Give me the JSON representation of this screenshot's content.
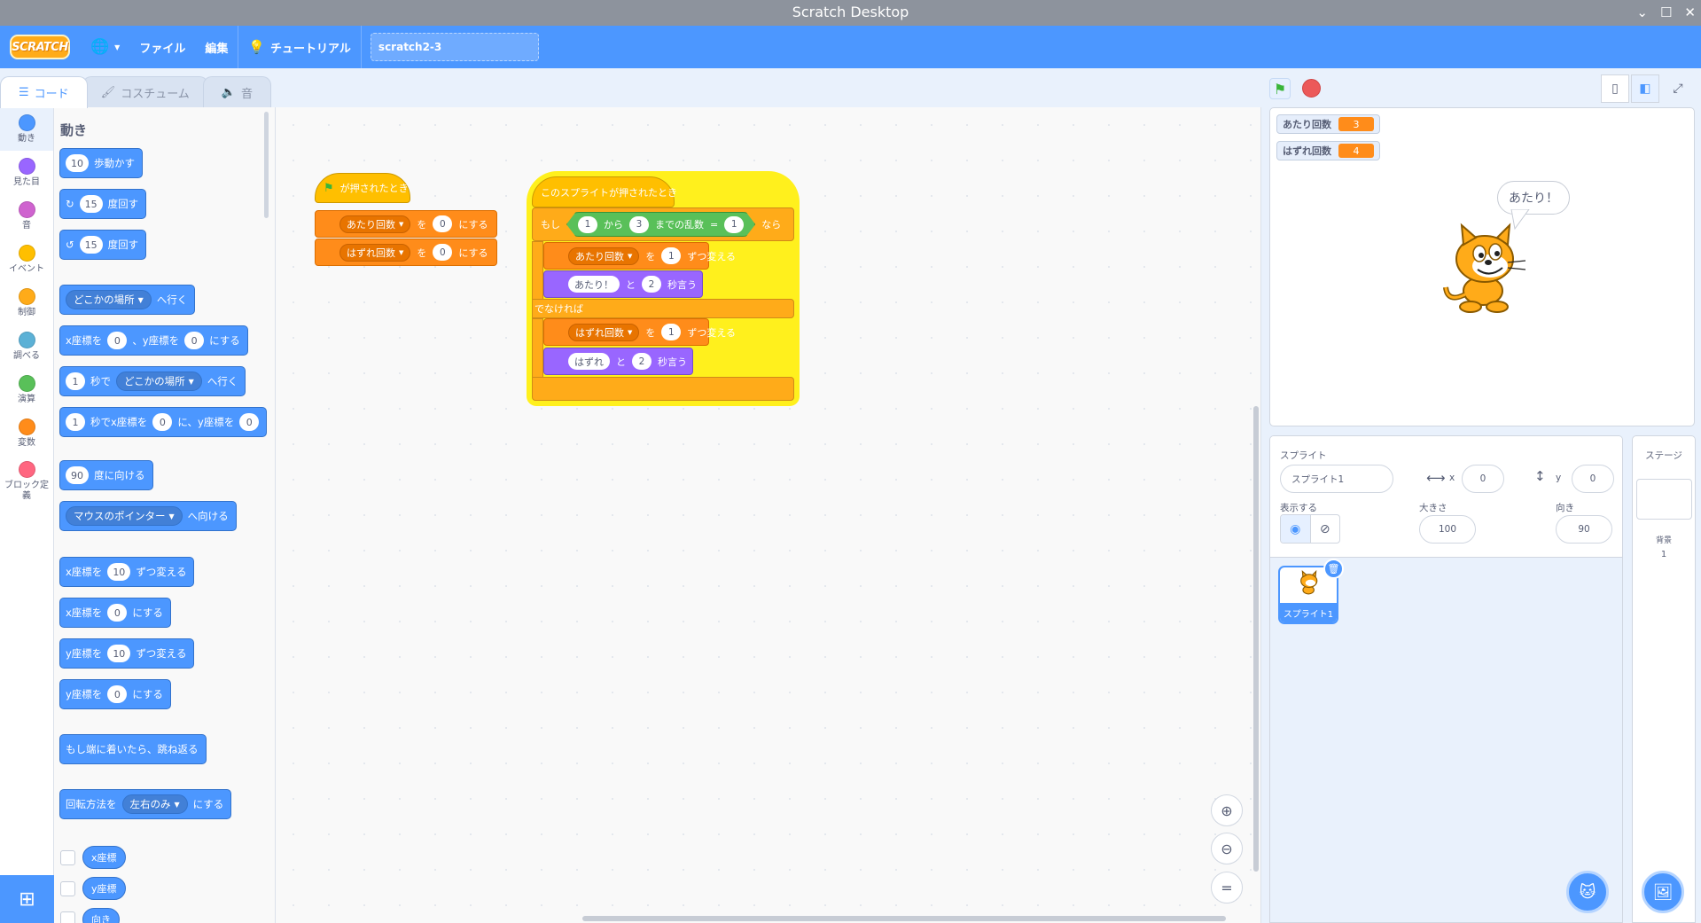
{
  "window": {
    "title": "Scratch Desktop"
  },
  "menubar": {
    "logo": "SCRATCH",
    "file": "ファイル",
    "edit": "編集",
    "tutorial": "チュートリアル",
    "project_title": "scratch2-3"
  },
  "tabs": {
    "code": "コード",
    "costumes": "コスチューム",
    "sounds": "音"
  },
  "categories": [
    {
      "label": "動き",
      "color": "#4c97ff"
    },
    {
      "label": "見た目",
      "color": "#9966ff"
    },
    {
      "label": "音",
      "color": "#cf63cf"
    },
    {
      "label": "イベント",
      "color": "#ffbf00"
    },
    {
      "label": "制御",
      "color": "#ffab19"
    },
    {
      "label": "調べる",
      "color": "#5cb1d6"
    },
    {
      "label": "演算",
      "color": "#59c059"
    },
    {
      "label": "変数",
      "color": "#ff8c1a"
    },
    {
      "label": "ブロック定義",
      "color": "#ff6680"
    }
  ],
  "palette": {
    "heading": "動き",
    "move": {
      "num": "10",
      "text": "歩動かす"
    },
    "turn_right": {
      "num": "15",
      "text": "度回す"
    },
    "turn_left": {
      "num": "15",
      "text": "度回す"
    },
    "goto": {
      "dd": "どこかの場所",
      "text": "へ行く"
    },
    "goto_xy": {
      "t1": "x座標を",
      "x": "0",
      "t2": "、y座標を",
      "y": "0",
      "t3": "にする"
    },
    "glide": {
      "num": "1",
      "t1": "秒で",
      "dd": "どこかの場所",
      "t2": "へ行く"
    },
    "glide_xy": {
      "num": "1",
      "t1": "秒でx座標を",
      "x": "0",
      "t2": "に、y座標を",
      "y": "0"
    },
    "point_dir": {
      "num": "90",
      "text": "度に向ける"
    },
    "point_towards": {
      "dd": "マウスのポインター",
      "text": "へ向ける"
    },
    "change_x": {
      "t1": "x座標を",
      "num": "10",
      "t2": "ずつ変える"
    },
    "set_x": {
      "t1": "x座標を",
      "num": "0",
      "t2": "にする"
    },
    "change_y": {
      "t1": "y座標を",
      "num": "10",
      "t2": "ずつ変える"
    },
    "set_y": {
      "t1": "y座標を",
      "num": "0",
      "t2": "にする"
    },
    "bounce": {
      "text": "もし端に着いたら、跳ね返る"
    },
    "rotation": {
      "t1": "回転方法を",
      "dd": "左右のみ",
      "t2": "にする"
    },
    "rep_x": "x座標",
    "rep_y": "y座標",
    "rep_dir": "向き"
  },
  "script1": {
    "hat": "が押されたとき",
    "set1": {
      "var": "あたり回数",
      "t1": "を",
      "val": "0",
      "t2": "にする"
    },
    "set2": {
      "var": "はずれ回数",
      "t1": "を",
      "val": "0",
      "t2": "にする"
    }
  },
  "script2": {
    "hat": "このスプライトが押されたとき",
    "if": "もし",
    "rand": {
      "from": "1",
      "t1": "から",
      "to": "3",
      "t2": "までの乱数",
      "eq": "=",
      "val": "1"
    },
    "then": "なら",
    "change1": {
      "var": "あたり回数",
      "t1": "を",
      "val": "1",
      "t2": "ずつ変える"
    },
    "say1": {
      "msg": "あたり！",
      "t1": "と",
      "secs": "2",
      "t2": "秒言う"
    },
    "else": "でなければ",
    "change2": {
      "var": "はずれ回数",
      "t1": "を",
      "val": "1",
      "t2": "ずつ変える"
    },
    "say2": {
      "msg": "はずれ",
      "t1": "と",
      "secs": "2",
      "t2": "秒言う"
    }
  },
  "stage": {
    "monitors": [
      {
        "label": "あたり回数",
        "value": "3"
      },
      {
        "label": "はずれ回数",
        "value": "4"
      }
    ],
    "bubble": "あたり！"
  },
  "sprite_info": {
    "sprite_label": "スプライト",
    "sprite_name": "スプライト1",
    "x_label": "x",
    "x": "0",
    "y_label": "y",
    "y": "0",
    "show_label": "表示する",
    "size_label": "大きさ",
    "size": "100",
    "direction_label": "向き",
    "direction": "90"
  },
  "sprite_list": [
    {
      "name": "スプライト1"
    }
  ],
  "stage_pane": {
    "title": "ステージ",
    "backdrops_label": "背景",
    "backdrops_count": "1"
  }
}
